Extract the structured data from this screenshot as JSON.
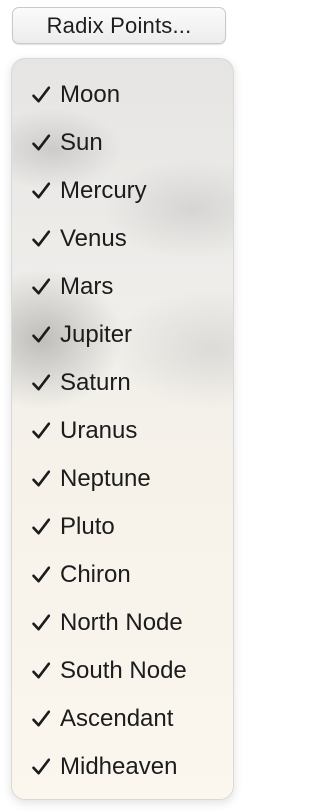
{
  "button": {
    "label": "Radix Points..."
  },
  "menu": {
    "items": [
      {
        "label": "Moon",
        "checked": true
      },
      {
        "label": "Sun",
        "checked": true
      },
      {
        "label": "Mercury",
        "checked": true
      },
      {
        "label": "Venus",
        "checked": true
      },
      {
        "label": "Mars",
        "checked": true
      },
      {
        "label": "Jupiter",
        "checked": true
      },
      {
        "label": "Saturn",
        "checked": true
      },
      {
        "label": "Uranus",
        "checked": true
      },
      {
        "label": "Neptune",
        "checked": true
      },
      {
        "label": "Pluto",
        "checked": true
      },
      {
        "label": "Chiron",
        "checked": true
      },
      {
        "label": "North Node",
        "checked": true
      },
      {
        "label": "South Node",
        "checked": true
      },
      {
        "label": "Ascendant",
        "checked": true
      },
      {
        "label": "Midheaven",
        "checked": true
      }
    ],
    "check_icon": "checkmark-icon"
  },
  "colors": {
    "text": "#1c1c1c",
    "menu_border": "#d9d9d9"
  }
}
